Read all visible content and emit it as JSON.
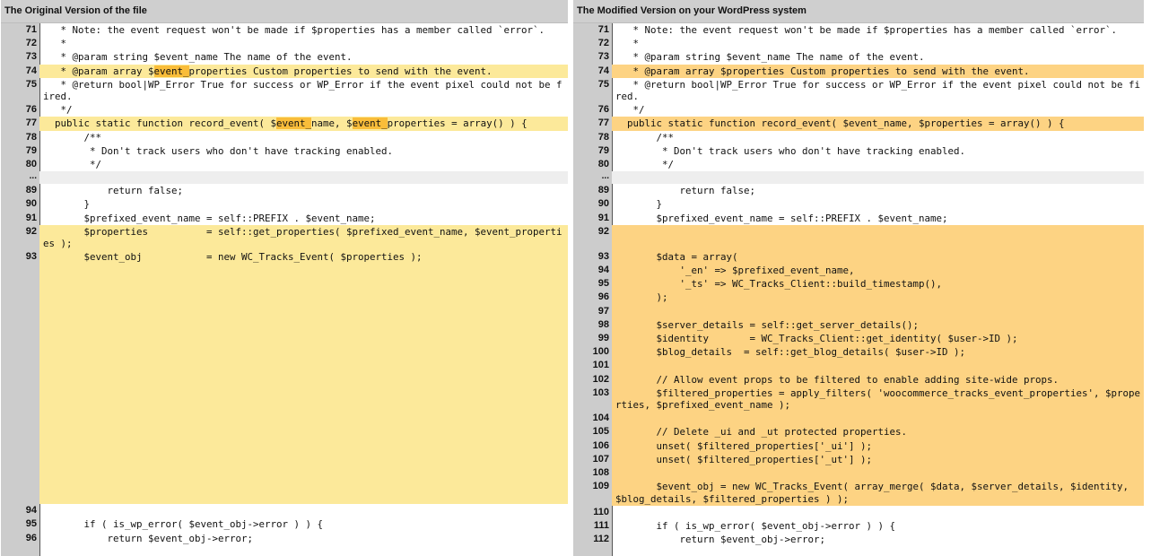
{
  "left": {
    "header": "The Original Version of the file",
    "lines": [
      {
        "n": "71",
        "t": "   * Note: the event request won't be made if $properties has a member called `error`."
      },
      {
        "n": "72",
        "t": "   *"
      },
      {
        "n": "73",
        "t": "   * @param string $event_name The name of the event."
      },
      {
        "n": "74",
        "t": "   * @param array $event_properties Custom properties to send with the event.",
        "hl": true,
        "mark": "event_"
      },
      {
        "n": "75",
        "t": "   * @return bool|WP_Error True for success or WP_Error if the event pixel could not be fired."
      },
      {
        "n": "76",
        "t": "   */"
      },
      {
        "n": "77",
        "t": "  public static function record_event( $event_name, $event_properties = array() ) {",
        "hl": true,
        "mark": "event_"
      },
      {
        "n": "78",
        "t": "       /**"
      },
      {
        "n": "79",
        "t": "        * Don't track users who don't have tracking enabled."
      },
      {
        "n": "80",
        "t": "        */"
      },
      {
        "n": "...",
        "t": "",
        "gap": true
      },
      {
        "n": "89",
        "t": "           return false;"
      },
      {
        "n": "90",
        "t": "       }"
      },
      {
        "n": "91",
        "t": "       $prefixed_event_name = self::PREFIX . $event_name;"
      },
      {
        "n": "92",
        "t": "       $properties          = self::get_properties( $prefixed_event_name, $event_properties );",
        "hl": true
      },
      {
        "n": "93",
        "t": "       $event_obj           = new WC_Tracks_Event( $properties );",
        "hl": true,
        "h": 283
      },
      {
        "n": "94",
        "t": ""
      },
      {
        "n": "95",
        "t": "       if ( is_wp_error( $event_obj->error ) ) {"
      },
      {
        "n": "96",
        "t": "           return $event_obj->error;"
      }
    ]
  },
  "right": {
    "header": "The Modified Version on your WordPress system",
    "lines": [
      {
        "n": "71",
        "t": "   * Note: the event request won't be made if $properties has a member called `error`."
      },
      {
        "n": "72",
        "t": "   *"
      },
      {
        "n": "73",
        "t": "   * @param string $event_name The name of the event."
      },
      {
        "n": "74",
        "t": "   * @param array $properties Custom properties to send with the event.",
        "hl": true
      },
      {
        "n": "75",
        "t": "   * @return bool|WP_Error True for success or WP_Error if the event pixel could not be fired."
      },
      {
        "n": "76",
        "t": "   */"
      },
      {
        "n": "77",
        "t": "  public static function record_event( $event_name, $properties = array() ) {",
        "hl": true
      },
      {
        "n": "78",
        "t": "       /**"
      },
      {
        "n": "79",
        "t": "        * Don't track users who don't have tracking enabled."
      },
      {
        "n": "80",
        "t": "        */"
      },
      {
        "n": "...",
        "t": "",
        "gap": true
      },
      {
        "n": "89",
        "t": "           return false;"
      },
      {
        "n": "90",
        "t": "       }"
      },
      {
        "n": "91",
        "t": "       $prefixed_event_name = self::PREFIX . $event_name;"
      },
      {
        "n": "92",
        "t": "",
        "hl": true,
        "h": 28
      },
      {
        "n": "93",
        "t": "       $data = array(",
        "hl": true
      },
      {
        "n": "94",
        "t": "           '_en' => $prefixed_event_name,",
        "hl": true
      },
      {
        "n": "95",
        "t": "           '_ts' => WC_Tracks_Client::build_timestamp(),",
        "hl": true
      },
      {
        "n": "96",
        "t": "       );",
        "hl": true
      },
      {
        "n": "97",
        "t": "",
        "hl": true
      },
      {
        "n": "98",
        "t": "       $server_details = self::get_server_details();",
        "hl": true
      },
      {
        "n": "99",
        "t": "       $identity       = WC_Tracks_Client::get_identity( $user->ID );",
        "hl": true
      },
      {
        "n": "100",
        "t": "       $blog_details  = self::get_blog_details( $user->ID );",
        "hl": true
      },
      {
        "n": "101",
        "t": "",
        "hl": true
      },
      {
        "n": "102",
        "t": "       // Allow event props to be filtered to enable adding site-wide props.",
        "hl": true
      },
      {
        "n": "103",
        "t": "       $filtered_properties = apply_filters( 'woocommerce_tracks_event_properties', $properties, $prefixed_event_name );",
        "hl": true
      },
      {
        "n": "104",
        "t": "",
        "hl": true
      },
      {
        "n": "105",
        "t": "       // Delete _ui and _ut protected properties.",
        "hl": true
      },
      {
        "n": "106",
        "t": "       unset( $filtered_properties['_ui'] );",
        "hl": true
      },
      {
        "n": "107",
        "t": "       unset( $filtered_properties['_ut'] );",
        "hl": true
      },
      {
        "n": "108",
        "t": "",
        "hl": true
      },
      {
        "n": "109",
        "t": "       $event_obj = new WC_Tracks_Event( array_merge( $data, $server_details, $identity, $blog_details, $filtered_properties ) );",
        "hl": true
      },
      {
        "n": "110",
        "t": ""
      },
      {
        "n": "111",
        "t": "       if ( is_wp_error( $event_obj->error ) ) {"
      },
      {
        "n": "112",
        "t": "           return $event_obj->error;"
      }
    ]
  },
  "colors": {
    "gutter": "#cccccc",
    "changed_left": "#fce99a",
    "changed_right": "#fdd383",
    "word_diff": "#f9bd3a"
  }
}
